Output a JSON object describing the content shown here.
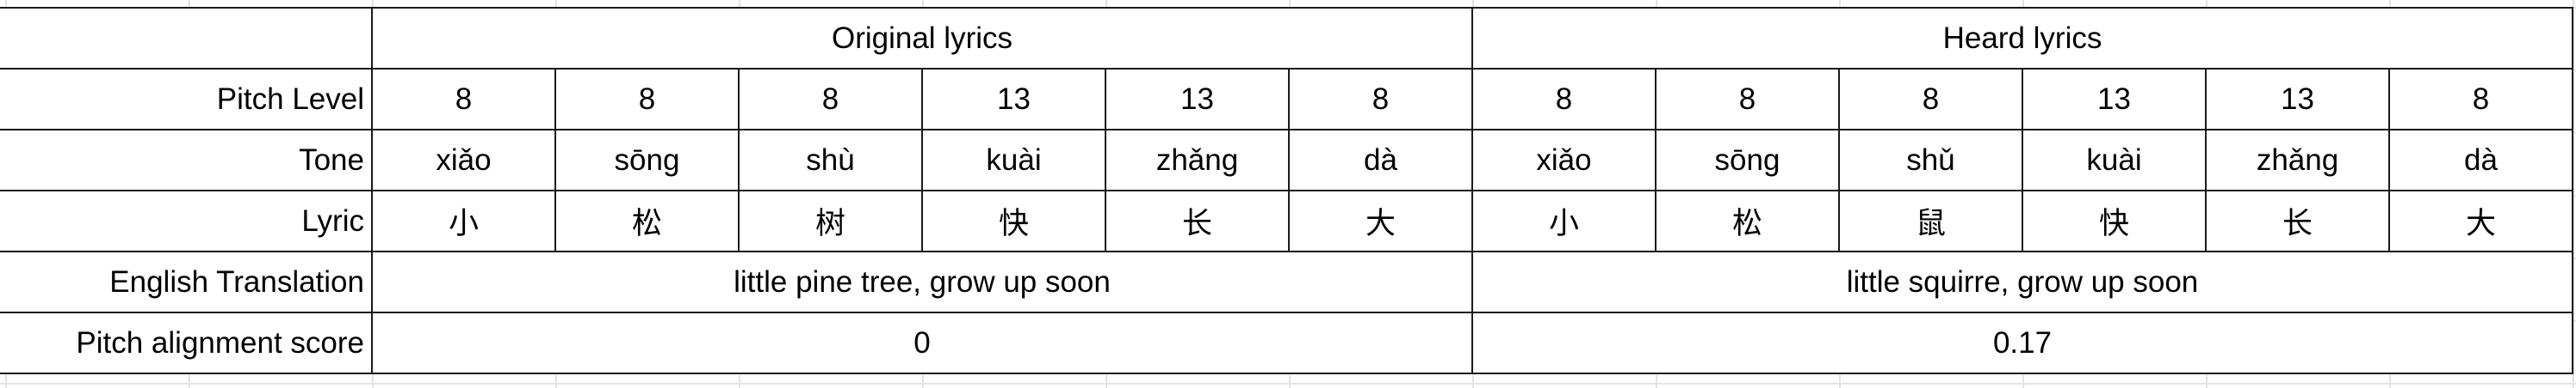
{
  "table": {
    "groups": [
      "Original lyrics",
      "Heard lyrics"
    ],
    "row_labels": {
      "pitch": "Pitch Level",
      "tone": "Tone",
      "lyric": "Lyric",
      "translation": "English Translation",
      "score": "Pitch alignment score"
    },
    "original": {
      "pitch": [
        "8",
        "8",
        "8",
        "13",
        "13",
        "8"
      ],
      "tone": [
        "xiǎo",
        "sōng",
        "shù",
        "kuài",
        "zhǎng",
        "dà"
      ],
      "lyric": [
        "小",
        "松",
        "树",
        "快",
        "长",
        "大"
      ],
      "translation": "little pine tree, grow up soon",
      "score": "0"
    },
    "heard": {
      "pitch": [
        "8",
        "8",
        "8",
        "13",
        "13",
        "8"
      ],
      "tone": [
        "xiǎo",
        "sōng",
        "shǔ",
        "kuài",
        "zhǎng",
        "dà"
      ],
      "lyric": [
        "小",
        "松",
        "鼠",
        "快",
        "长",
        "大"
      ],
      "translation": "little squirre, grow up soon",
      "score": "0.17"
    }
  }
}
